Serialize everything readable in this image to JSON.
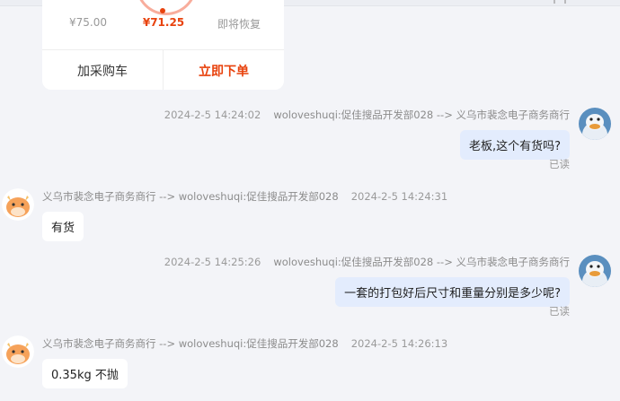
{
  "product": {
    "price_original": "¥75.00",
    "price_current": "¥71.25",
    "restore_label": "即将恢复",
    "add_to_cart": "加采购车",
    "order_now": "立即下单"
  },
  "messages": [
    {
      "side": "me",
      "time": "2024-2-5 14:24:02",
      "route": "woloveshuqi:促佳搜品开发部028 --> 义乌市裴念电子商务商行",
      "text": "老板,这个有货吗?",
      "status": "已读"
    },
    {
      "side": "them",
      "route": "义乌市裴念电子商务商行 --> woloveshuqi:促佳搜品开发部028",
      "time": "2024-2-5 14:24:31",
      "text": "有货"
    },
    {
      "side": "me",
      "time": "2024-2-5 14:25:26",
      "route": "woloveshuqi:促佳搜品开发部028 --> 义乌市裴念电子商务商行",
      "text": "一套的打包好后尺寸和重量分别是多少呢?",
      "status": "已读"
    },
    {
      "side": "them",
      "route": "义乌市裴念电子商务商行 --> woloveshuqi:促佳搜品开发部028",
      "time": "2024-2-5 14:26:13",
      "text": "0.35kg 不抛"
    }
  ],
  "colors": {
    "accent": "#e8420d",
    "my_bubble": "#e3ecfd",
    "their_bubble": "#ffffff",
    "background": "#f3f4f8"
  },
  "icons": {
    "my_avatar": "duck-avatar-icon",
    "their_avatar": "cow-avatar-icon"
  }
}
